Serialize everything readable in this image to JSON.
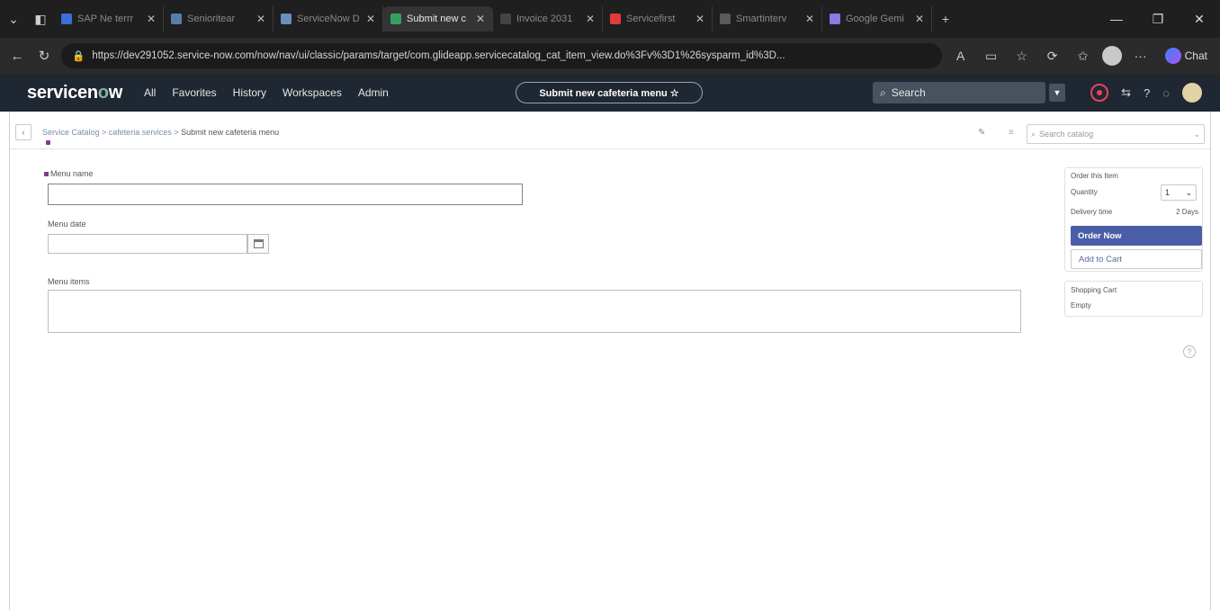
{
  "browser": {
    "tabs": [
      {
        "label": "SAP Ne terrr",
        "color": "#3a6fd8",
        "active": false
      },
      {
        "label": "Senioritear",
        "color": "#5a7ca8",
        "active": false
      },
      {
        "label": "ServiceNow D",
        "color": "#6b8fbf",
        "active": false
      },
      {
        "label": "Submit new c",
        "color": "#33a060",
        "active": true
      },
      {
        "label": "Invoice 2031",
        "color": "#444444",
        "active": false
      },
      {
        "label": "Servicefirst",
        "color": "#e23b3b",
        "active": false
      },
      {
        "label": "Smartinterv",
        "color": "#5a5a5a",
        "active": false
      },
      {
        "label": "Google Gemi",
        "color": "#8a7be0",
        "active": false
      }
    ],
    "new_tab": "+",
    "win_minimize": "—",
    "win_restore": "❐",
    "win_close": "✕",
    "url": "https://dev291052.service-now.com/now/nav/ui/classic/params/target/com.glideapp.servicecatalog_cat_item_view.do%3Fv%3D1%26sysparm_id%3D...",
    "chat_label": "Chat"
  },
  "servicenow": {
    "logo_text_a": "servicen",
    "logo_text_o": "o",
    "logo_text_b": "w",
    "menu": [
      "All",
      "Favorites",
      "History",
      "Workspaces",
      "Admin"
    ],
    "context_pill": "Submit new cafeteria menu ☆",
    "search_placeholder": "Search"
  },
  "page": {
    "breadcrumb_links": "Service Catalog > cafeteria services > ",
    "breadcrumb_current": "Submit new cafeteria menu",
    "catalog_search_placeholder": "Search catalog",
    "fields": {
      "menu_name_label": "Menu name",
      "menu_name_value": "",
      "menu_date_label": "Menu date",
      "menu_date_value": "",
      "menu_items_label": "Menu items",
      "menu_items_value": ""
    },
    "order": {
      "title": "Order this Item",
      "quantity_label": "Quantity",
      "quantity_value": "1",
      "delivery_label": "Delivery time",
      "delivery_value": "2 Days",
      "order_now": "Order Now",
      "add_to_cart": "Add to Cart"
    },
    "cart": {
      "title": "Shopping Cart",
      "status": "Empty"
    }
  },
  "colors": {
    "sn_header": "#1f2732",
    "order_now_button": "#4a5ea8",
    "required_marker": "#7f3b8f"
  }
}
